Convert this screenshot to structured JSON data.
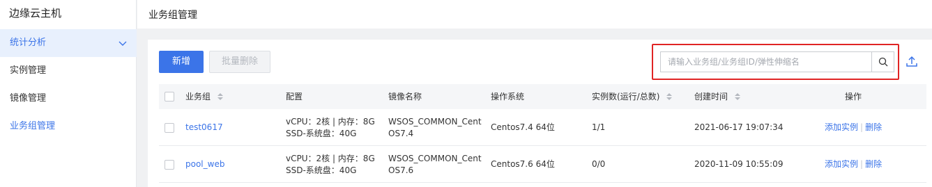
{
  "sidebar": {
    "title": "边缘云主机",
    "items": [
      {
        "label": "统计分析"
      },
      {
        "label": "实例管理"
      },
      {
        "label": "镜像管理"
      },
      {
        "label": "业务组管理"
      }
    ]
  },
  "header": {
    "title": "业务组管理"
  },
  "toolbar": {
    "add_label": "新增",
    "batch_delete_label": "批量删除",
    "search_placeholder": "请输入业务组/业务组ID/弹性伸缩名"
  },
  "table": {
    "columns": [
      "业务组",
      "配置",
      "镜像名称",
      "操作系统",
      "实例数(运行/总数)",
      "创建时间",
      "操作"
    ],
    "rows": [
      {
        "name": "test0617",
        "config_line1": "vCPU：2核 | 内存：8G",
        "config_line2": "SSD-系统盘：40G",
        "image_line1": "WSOS_COMMON_Cent",
        "image_line2": "OS7.4",
        "os": "Centos7.4 64位",
        "instances": "1/1",
        "created": "2021-06-17 19:07:34",
        "action_add": "添加实例",
        "action_delete": "删除"
      },
      {
        "name": "pool_web",
        "config_line1": "vCPU：2核 | 内存：8G",
        "config_line2": "SSD-系统盘：40G",
        "image_line1": "WSOS_COMMON_Cent",
        "image_line2": "OS7.6",
        "os": "Centos7.6 64位",
        "instances": "0/0",
        "created": "2020-11-09 10:55:09",
        "action_add": "添加实例",
        "action_delete": "删除"
      }
    ]
  },
  "colors": {
    "accent": "#3b74e8",
    "highlight": "#e02424"
  }
}
